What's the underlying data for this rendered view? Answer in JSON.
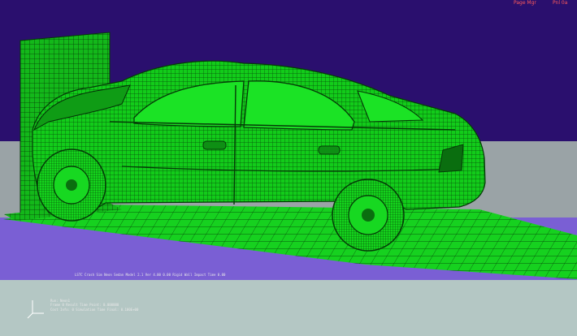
{
  "viewer": {
    "top_right_left": "Page Mgr",
    "top_right_right": "Pnl 0a"
  },
  "status": {
    "model_line": "LSTC Crash Sim   Neon Sedan Model 2.1   Ver 4.00  0.00 Rigid Wall Impact  Time 0.00",
    "state_line_1": "Run: Neon1",
    "state_line_2": "Frame  0        Result Time Point:  0.000000",
    "state_line_3": "Cost Info:  0   Simulation Time Final:  0.100E+00"
  },
  "colors": {
    "sky": "#2a0f6e",
    "floor_far": "#9aa3a6",
    "floor_band": "#7a5fd4",
    "floor_near": "#b4c7c4",
    "mesh_fill": "#12cc1a",
    "mesh_line": "#063d08",
    "hud_text": "#ff5a5a"
  }
}
